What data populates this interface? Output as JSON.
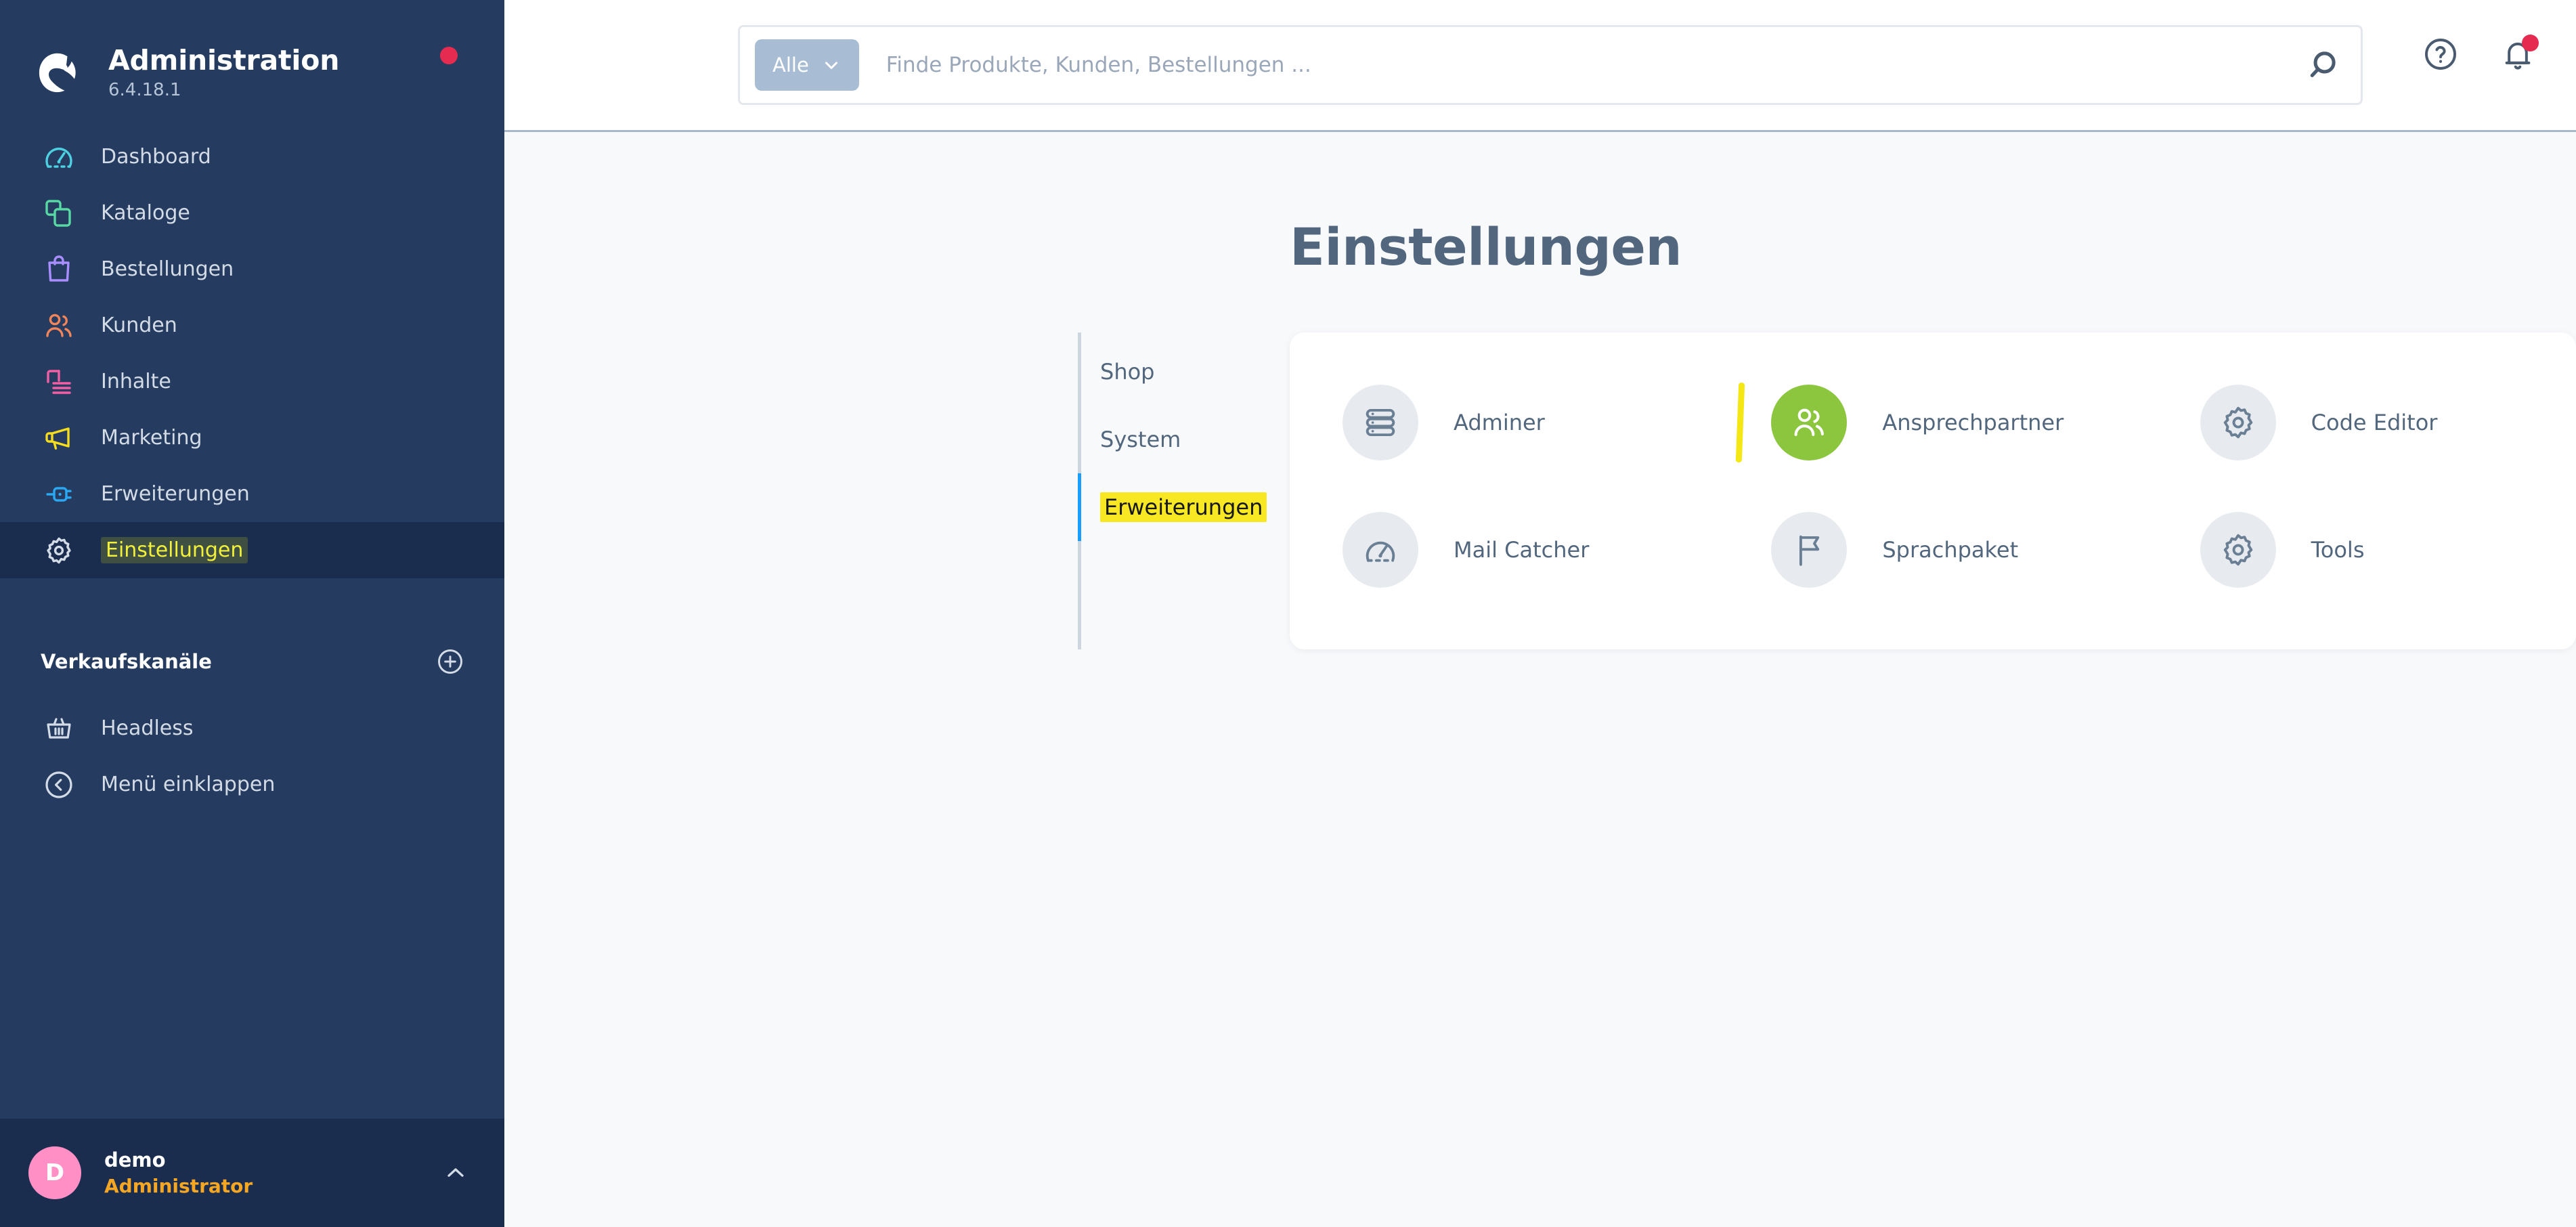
{
  "brand": {
    "title": "Administration",
    "version": "6.4.18.1",
    "logo_icon": "shopware-logo-icon",
    "status_dot_color": "#e52b50"
  },
  "sidebar": {
    "items": [
      {
        "label": "Dashboard",
        "icon": "gauge-icon",
        "color": "#4dd0e1",
        "active": false,
        "highlighted": false
      },
      {
        "label": "Kataloge",
        "icon": "layers-icon",
        "color": "#57d9a3",
        "active": false,
        "highlighted": false
      },
      {
        "label": "Bestellungen",
        "icon": "bag-icon",
        "color": "#a98eff",
        "active": false,
        "highlighted": false
      },
      {
        "label": "Kunden",
        "icon": "users-icon",
        "color": "#f0845a",
        "active": false,
        "highlighted": false
      },
      {
        "label": "Inhalte",
        "icon": "content-icon",
        "color": "#f25fa4",
        "active": false,
        "highlighted": false
      },
      {
        "label": "Marketing",
        "icon": "megaphone-icon",
        "color": "#f5dd1e",
        "active": false,
        "highlighted": false
      },
      {
        "label": "Erweiterungen",
        "icon": "plug-icon",
        "color": "#2aa8f2",
        "active": false,
        "highlighted": false
      },
      {
        "label": "Einstellungen",
        "icon": "gear-icon",
        "color": "#d3dbe6",
        "active": true,
        "highlighted": true
      }
    ],
    "section": {
      "title": "Verkaufskanäle",
      "add_icon": "plus-circle-icon"
    },
    "sub_items": [
      {
        "label": "Headless",
        "icon": "basket-icon"
      },
      {
        "label": "Menü einklappen",
        "icon": "chevron-left-circle-icon"
      }
    ],
    "user": {
      "initial": "D",
      "name": "demo",
      "role": "Administrator",
      "chevron_icon": "chevron-up-icon",
      "avatar_color": "#ff8fc4",
      "role_color": "#f5a623"
    }
  },
  "topbar": {
    "search": {
      "scope_label": "Alle",
      "scope_chevron_icon": "chevron-down-icon",
      "placeholder": "Finde Produkte, Kunden, Bestellungen ...",
      "value": "",
      "submit_icon": "search-icon"
    },
    "help_icon": "question-circle-icon",
    "notifications_icon": "bell-icon",
    "notifications_has_badge": true
  },
  "page": {
    "title": "Einstellungen"
  },
  "tabs": [
    {
      "label": "Shop",
      "active": false
    },
    {
      "label": "System",
      "active": false
    },
    {
      "label": "Erweiterungen",
      "active": true
    }
  ],
  "cards": [
    {
      "label": "Adminer",
      "icon": "database-icon",
      "accent": false,
      "cursor": false
    },
    {
      "label": "Ansprechpartner",
      "icon": "users-icon",
      "accent": true,
      "cursor": true
    },
    {
      "label": "Code Editor",
      "icon": "gear-icon",
      "accent": false,
      "cursor": false
    },
    {
      "label": "Mail Catcher",
      "icon": "gauge-icon",
      "accent": false,
      "cursor": false
    },
    {
      "label": "Sprachpaket",
      "icon": "flag-icon",
      "accent": false,
      "cursor": false
    },
    {
      "label": "Tools",
      "icon": "gear-icon",
      "accent": false,
      "cursor": false
    }
  ],
  "colors": {
    "sidebar_bg": "#253b5f",
    "sidebar_active_bg": "#1b2d4f",
    "content_bg": "#f8f9fb",
    "card_bg": "#ffffff",
    "text_primary": "#52677d",
    "accent_blue": "#189eff",
    "accent_green": "#8cc63e",
    "highlight_yellow": "#f8e612"
  }
}
